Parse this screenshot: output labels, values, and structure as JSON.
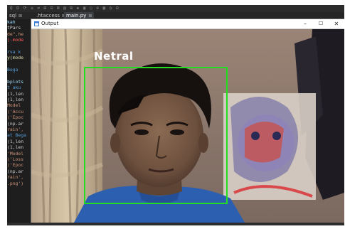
{
  "editor": {
    "toolbar_glyphs": "Q  ⊡  ⟳  ≡  ⇄  ⊞  ⊟  ⊠  ▤  ⊞  ◈  ▣  ○  ⊕  ▦  ◷  ⊟",
    "tabs": [
      {
        "label": "sql",
        "close": "⊠"
      },
      {
        "label": ".htaccess",
        "close": "⊠"
      },
      {
        "label": "main.py",
        "close": "⊠"
      }
    ],
    "code_lines": [
      {
        "text": "kah",
        "color": "#9cdcfe"
      },
      {
        "text": "tPars",
        "color": "#cfcfcf"
      },
      {
        "text": "de\",he",
        "color": "#ce9178"
      },
      {
        "text": ").mode",
        "color": "#ff5a5a"
      },
      {
        "text": "",
        "color": "#9cdcfe"
      },
      {
        "text": "rva k",
        "color": "#569cd6"
      },
      {
        "text": "y(mode",
        "color": "#dcdcaa"
      },
      {
        "text": "",
        "color": "#9cdcfe"
      },
      {
        "text": "Bega",
        "color": "#569cd6"
      },
      {
        "text": "",
        "color": "#9cdcfe"
      },
      {
        "text": "bplots",
        "color": "#9cdcfe"
      },
      {
        "text": "t aku",
        "color": "#569cd6"
      },
      {
        "text": "(1,len",
        "color": "#cfcfcf"
      },
      {
        "text": "(1,len",
        "color": "#cfcfcf"
      },
      {
        "text": "Model",
        "color": "#ce9178"
      },
      {
        "text": "('Accu",
        "color": "#ce9178"
      },
      {
        "text": "('Epoc",
        "color": "#ce9178"
      },
      {
        "text": "(np.ar",
        "color": "#cfcfcf"
      },
      {
        "text": "rain',",
        "color": "#ce9178"
      },
      {
        "text": "at Bega",
        "color": "#569cd6"
      },
      {
        "text": "(1,len",
        "color": "#cfcfcf"
      },
      {
        "text": "(1,len",
        "color": "#cfcfcf"
      },
      {
        "text": "'Model",
        "color": "#ce9178"
      },
      {
        "text": "('Loss",
        "color": "#ce9178"
      },
      {
        "text": "('Epoc",
        "color": "#ce9178"
      },
      {
        "text": "(np.ar",
        "color": "#cfcfcf"
      },
      {
        "text": "rain',",
        "color": "#ce9178"
      },
      {
        "text": ".png')",
        "color": "#ce9178"
      },
      {
        "text": "",
        "color": "#9cdcfe"
      }
    ]
  },
  "window": {
    "title": "Output",
    "minimize": "–",
    "maximize": "☐",
    "close": "✕"
  },
  "detection": {
    "label": "Netral",
    "box_color": "#22dd22"
  }
}
